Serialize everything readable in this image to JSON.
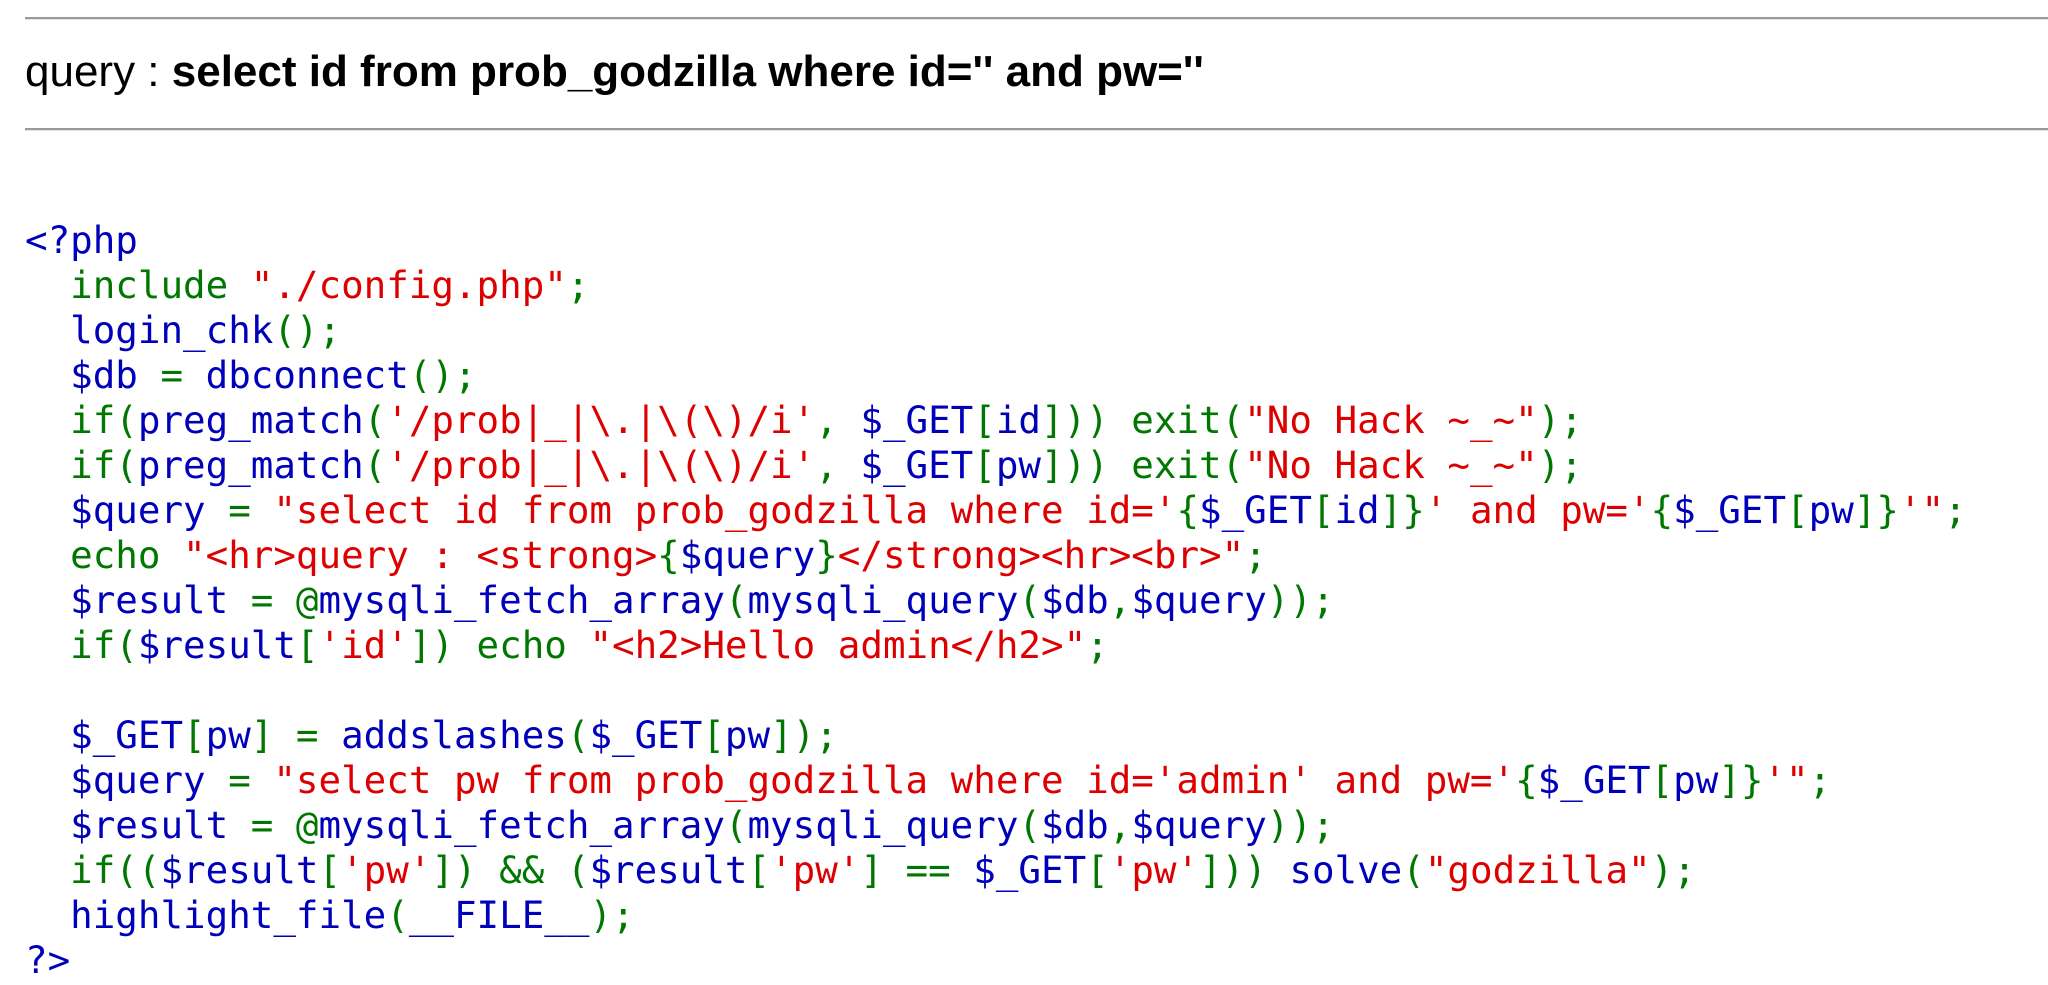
{
  "header": {
    "query_label": "query : ",
    "query_text": "select id from prob_godzilla where id='' and pw=''"
  },
  "source": {
    "lines": [
      [
        [
          "default",
          "<?php"
        ]
      ],
      [
        [
          "default",
          "  "
        ],
        [
          "keyword",
          "include "
        ],
        [
          "string",
          "\"./config.php\""
        ],
        [
          "keyword",
          ";"
        ]
      ],
      [
        [
          "default",
          "  login_chk"
        ],
        [
          "keyword",
          "();"
        ]
      ],
      [
        [
          "default",
          "  $db "
        ],
        [
          "keyword",
          "= "
        ],
        [
          "default",
          "dbconnect"
        ],
        [
          "keyword",
          "();"
        ]
      ],
      [
        [
          "default",
          "  "
        ],
        [
          "keyword",
          "if("
        ],
        [
          "default",
          "preg_match"
        ],
        [
          "keyword",
          "("
        ],
        [
          "string",
          "'/prob|_|\\.|\\(\\)/i'"
        ],
        [
          "keyword",
          ", "
        ],
        [
          "default",
          "$_GET"
        ],
        [
          "keyword",
          "["
        ],
        [
          "default",
          "id"
        ],
        [
          "keyword",
          "])) exit("
        ],
        [
          "string",
          "\"No Hack ~_~\""
        ],
        [
          "keyword",
          ");"
        ]
      ],
      [
        [
          "default",
          "  "
        ],
        [
          "keyword",
          "if("
        ],
        [
          "default",
          "preg_match"
        ],
        [
          "keyword",
          "("
        ],
        [
          "string",
          "'/prob|_|\\.|\\(\\)/i'"
        ],
        [
          "keyword",
          ", "
        ],
        [
          "default",
          "$_GET"
        ],
        [
          "keyword",
          "["
        ],
        [
          "default",
          "pw"
        ],
        [
          "keyword",
          "])) exit("
        ],
        [
          "string",
          "\"No Hack ~_~\""
        ],
        [
          "keyword",
          ");"
        ]
      ],
      [
        [
          "default",
          "  $query "
        ],
        [
          "keyword",
          "= "
        ],
        [
          "string",
          "\"select id from prob_godzilla where id='"
        ],
        [
          "keyword",
          "{"
        ],
        [
          "default",
          "$_GET"
        ],
        [
          "keyword",
          "["
        ],
        [
          "default",
          "id"
        ],
        [
          "keyword",
          "]}"
        ],
        [
          "string",
          "' and pw='"
        ],
        [
          "keyword",
          "{"
        ],
        [
          "default",
          "$_GET"
        ],
        [
          "keyword",
          "["
        ],
        [
          "default",
          "pw"
        ],
        [
          "keyword",
          "]}"
        ],
        [
          "string",
          "'\""
        ],
        [
          "keyword",
          ";"
        ]
      ],
      [
        [
          "default",
          "  "
        ],
        [
          "keyword",
          "echo "
        ],
        [
          "string",
          "\"<hr>query : <strong>"
        ],
        [
          "keyword",
          "{"
        ],
        [
          "default",
          "$query"
        ],
        [
          "keyword",
          "}"
        ],
        [
          "string",
          "</strong><hr><br>\""
        ],
        [
          "keyword",
          ";"
        ]
      ],
      [
        [
          "default",
          "  $result "
        ],
        [
          "keyword",
          "= @"
        ],
        [
          "default",
          "mysqli_fetch_array"
        ],
        [
          "keyword",
          "("
        ],
        [
          "default",
          "mysqli_query"
        ],
        [
          "keyword",
          "("
        ],
        [
          "default",
          "$db"
        ],
        [
          "keyword",
          ","
        ],
        [
          "default",
          "$query"
        ],
        [
          "keyword",
          "));"
        ]
      ],
      [
        [
          "default",
          "  "
        ],
        [
          "keyword",
          "if("
        ],
        [
          "default",
          "$result"
        ],
        [
          "keyword",
          "["
        ],
        [
          "string",
          "'id'"
        ],
        [
          "keyword",
          "]) echo "
        ],
        [
          "string",
          "\"<h2>Hello admin</h2>\""
        ],
        [
          "keyword",
          ";"
        ]
      ],
      [
        [
          "default",
          ""
        ]
      ],
      [
        [
          "default",
          "  $_GET"
        ],
        [
          "keyword",
          "["
        ],
        [
          "default",
          "pw"
        ],
        [
          "keyword",
          "] = "
        ],
        [
          "default",
          "addslashes"
        ],
        [
          "keyword",
          "("
        ],
        [
          "default",
          "$_GET"
        ],
        [
          "keyword",
          "["
        ],
        [
          "default",
          "pw"
        ],
        [
          "keyword",
          "]);"
        ]
      ],
      [
        [
          "default",
          "  $query "
        ],
        [
          "keyword",
          "= "
        ],
        [
          "string",
          "\"select pw from prob_godzilla where id='admin' and pw='"
        ],
        [
          "keyword",
          "{"
        ],
        [
          "default",
          "$_GET"
        ],
        [
          "keyword",
          "["
        ],
        [
          "default",
          "pw"
        ],
        [
          "keyword",
          "]}"
        ],
        [
          "string",
          "'\""
        ],
        [
          "keyword",
          ";"
        ]
      ],
      [
        [
          "default",
          "  $result "
        ],
        [
          "keyword",
          "= @"
        ],
        [
          "default",
          "mysqli_fetch_array"
        ],
        [
          "keyword",
          "("
        ],
        [
          "default",
          "mysqli_query"
        ],
        [
          "keyword",
          "("
        ],
        [
          "default",
          "$db"
        ],
        [
          "keyword",
          ","
        ],
        [
          "default",
          "$query"
        ],
        [
          "keyword",
          "));"
        ]
      ],
      [
        [
          "default",
          "  "
        ],
        [
          "keyword",
          "if(("
        ],
        [
          "default",
          "$result"
        ],
        [
          "keyword",
          "["
        ],
        [
          "string",
          "'pw'"
        ],
        [
          "keyword",
          "]) && ("
        ],
        [
          "default",
          "$result"
        ],
        [
          "keyword",
          "["
        ],
        [
          "string",
          "'pw'"
        ],
        [
          "keyword",
          "] == "
        ],
        [
          "default",
          "$_GET"
        ],
        [
          "keyword",
          "["
        ],
        [
          "string",
          "'pw'"
        ],
        [
          "keyword",
          "])) "
        ],
        [
          "default",
          "solve"
        ],
        [
          "keyword",
          "("
        ],
        [
          "string",
          "\"godzilla\""
        ],
        [
          "keyword",
          ");"
        ]
      ],
      [
        [
          "default",
          "  highlight_file"
        ],
        [
          "keyword",
          "("
        ],
        [
          "default",
          "__FILE__"
        ],
        [
          "keyword",
          ");"
        ]
      ],
      [
        [
          "default",
          "?>"
        ]
      ]
    ]
  },
  "colors": {
    "default": "#0000bb",
    "keyword": "#007700",
    "string": "#dd0000",
    "rule": "#9a9a9a"
  }
}
